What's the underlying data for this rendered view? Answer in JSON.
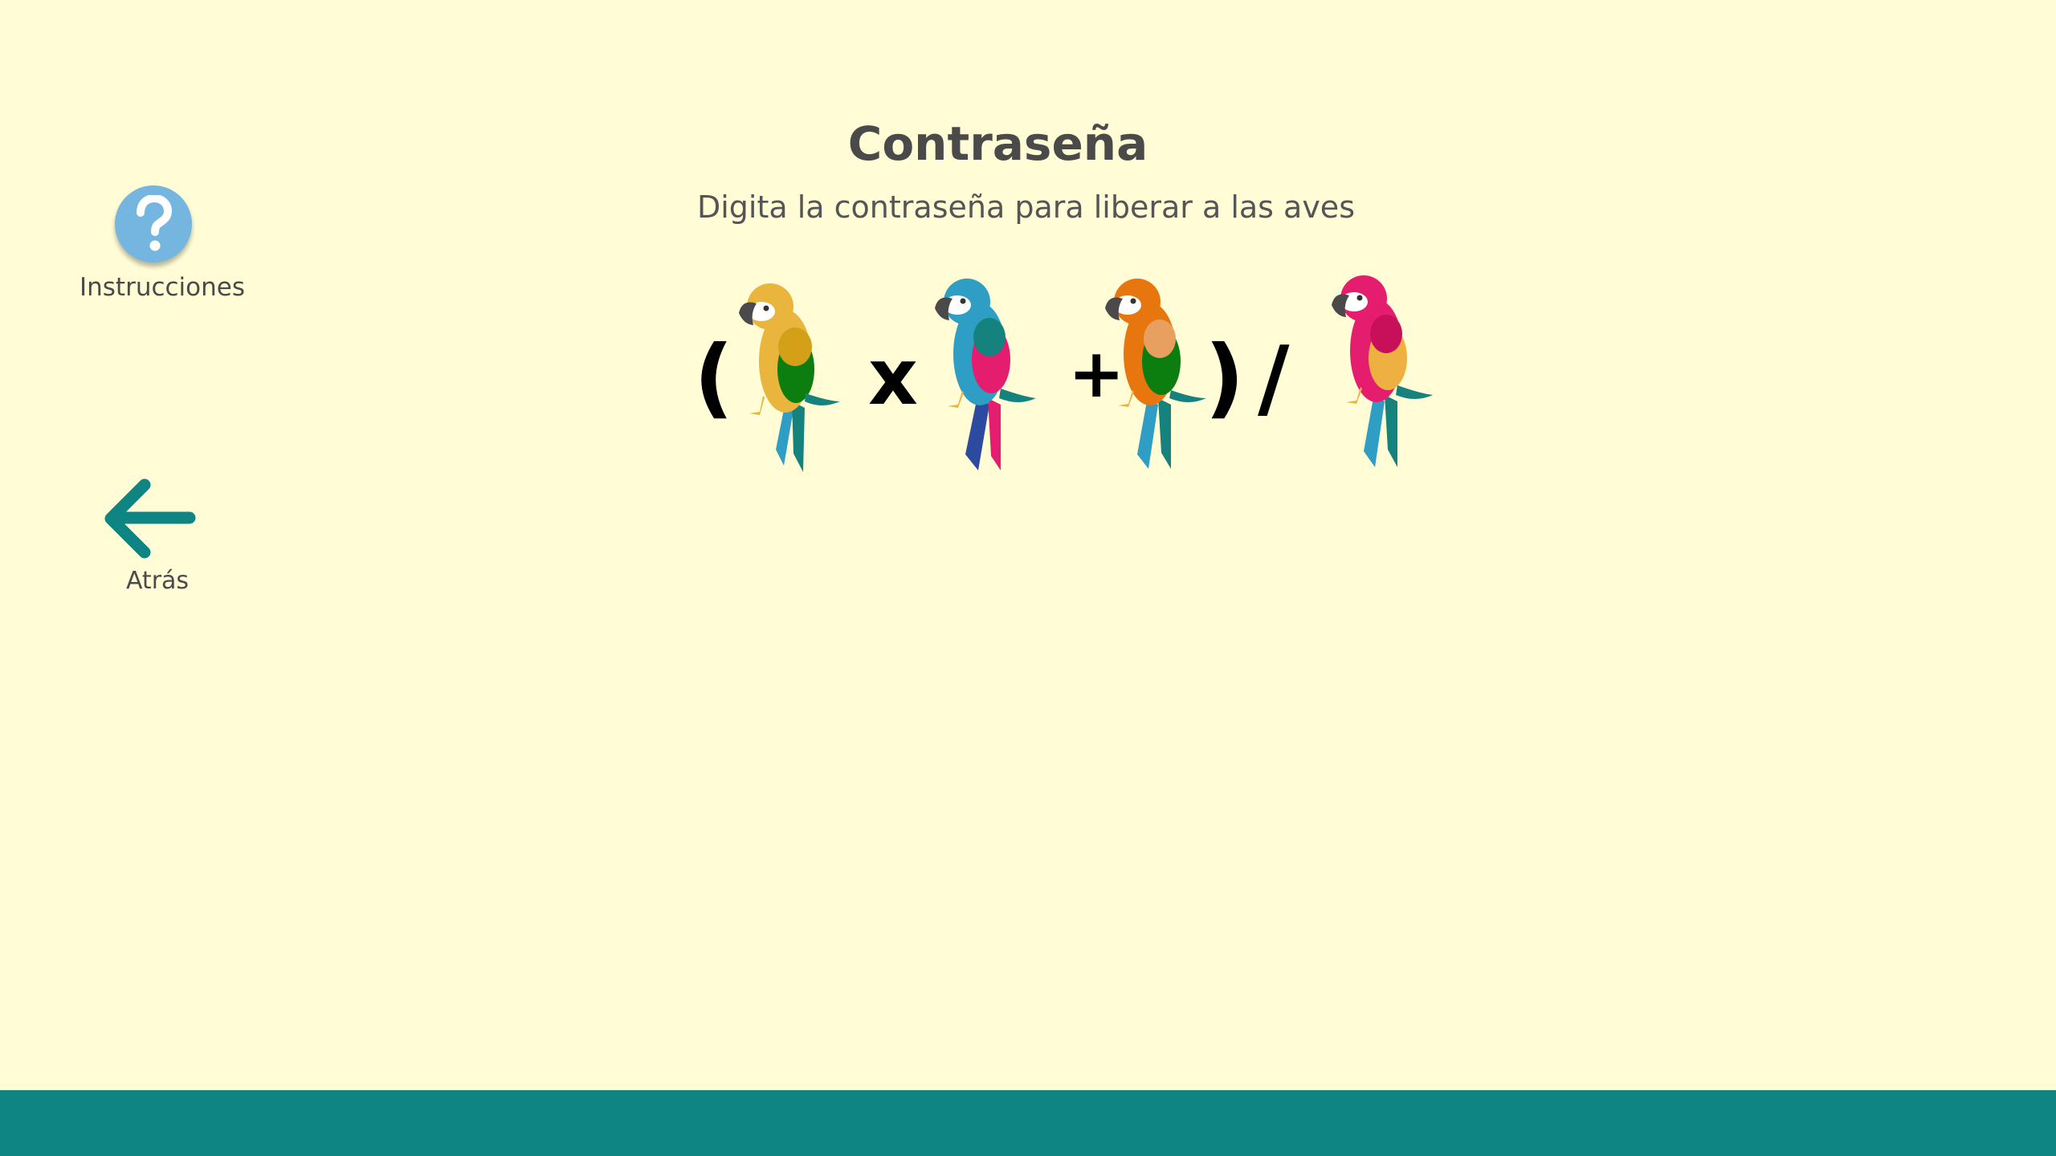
{
  "header": {
    "title": "Contraseña",
    "subtitle": "Digita la contraseña para liberar a las aves"
  },
  "sidebar": {
    "instructions_label": "Instrucciones",
    "back_label": "Atrás"
  },
  "equation": {
    "open_paren": "(",
    "times": "x",
    "plus": "+",
    "close_paren": ")",
    "divide": "/",
    "parrots": [
      "yellow-parrot",
      "blue-parrot",
      "orange-parrot",
      "pink-parrot"
    ]
  },
  "colors": {
    "background": "#fffcd6",
    "accent": "#0e8582",
    "help_button": "#74b6df",
    "text": "#4a4a4a"
  }
}
